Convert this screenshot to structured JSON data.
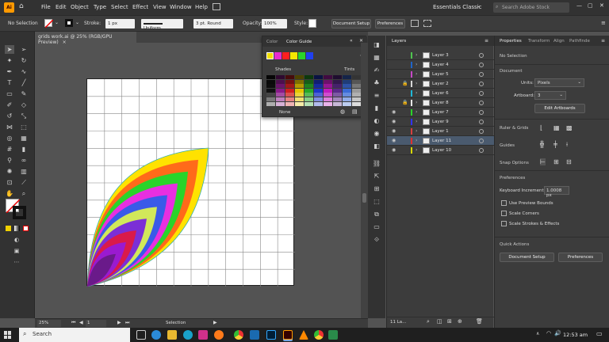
{
  "menubar": {
    "app_logo": "Ai",
    "items": [
      "File",
      "Edit",
      "Object",
      "Type",
      "Select",
      "Effect",
      "View",
      "Window",
      "Help"
    ],
    "workspace": "Essentials Classic",
    "search_placeholder": "Search Adobe Stock"
  },
  "control_bar": {
    "selection_label": "No Selection",
    "stroke_label": "Stroke:",
    "stroke_value": "1 px",
    "uniform": "Uniform",
    "brush": "3 pt. Round",
    "opacity_label": "Opacity:",
    "opacity_value": "100%",
    "style_label": "Style:",
    "document_setup": "Document Setup",
    "preferences": "Preferences"
  },
  "document": {
    "tab_title": "grids work.ai @ 25% (RGB/GPU Preview)",
    "close": "×"
  },
  "status_bar": {
    "zoom": "25%",
    "artboard_num": "1",
    "status": "Selection"
  },
  "color_guide": {
    "tab_color": "Color",
    "tab_guide": "Color Guide",
    "shades_label": "Shades",
    "tints_label": "Tints",
    "none_label": "None",
    "harmony": [
      "#f2e000",
      "#e62cd2",
      "#ff1f1f",
      "#f5e600",
      "#2ad42a",
      "#2040f0"
    ],
    "grid_columns": [
      "#111111",
      "#8a1a8a",
      "#d01f1f",
      "#e5c600",
      "#27a827",
      "#1c36c9",
      "#c01cc0",
      "#5a2a8a",
      "#3a6bd6",
      "#9a9a9a"
    ]
  },
  "layers_panel": {
    "title": "Layers",
    "layers": [
      {
        "name": "Layer 3",
        "visible": false,
        "locked": false,
        "color": "#4fc54f",
        "selected": false
      },
      {
        "name": "Layer 4",
        "visible": false,
        "locked": false,
        "color": "#1f64c8",
        "selected": false
      },
      {
        "name": "Layer 5",
        "visible": false,
        "locked": false,
        "color": "#c848c8",
        "selected": false
      },
      {
        "name": "Layer 2",
        "visible": false,
        "locked": true,
        "color": "#d8d8d8",
        "selected": false
      },
      {
        "name": "Layer 6",
        "visible": false,
        "locked": false,
        "color": "#1fb8d8",
        "selected": false
      },
      {
        "name": "Layer 8",
        "visible": false,
        "locked": true,
        "color": "#e8e8e8",
        "selected": false
      },
      {
        "name": "Layer 7",
        "visible": true,
        "locked": false,
        "color": "#2ad42a",
        "selected": false
      },
      {
        "name": "Layer 9",
        "visible": true,
        "locked": false,
        "color": "#3232ff",
        "selected": false
      },
      {
        "name": "Layer 1",
        "visible": true,
        "locked": false,
        "color": "#d84040",
        "selected": false
      },
      {
        "name": "Layer 11",
        "visible": true,
        "locked": false,
        "color": "#e03030",
        "selected": true
      },
      {
        "name": "Layer 10",
        "visible": true,
        "locked": false,
        "color": "#d8d800",
        "selected": false
      }
    ],
    "count": "11 La..."
  },
  "properties_panel": {
    "tabs": [
      "Properties",
      "Transform",
      "Align",
      "Pathfinde"
    ],
    "no_selection": "No Selection",
    "document_header": "Document",
    "units_label": "Units:",
    "units_value": "Pixels",
    "artboard_label": "Artboard:",
    "artboard_value": "3",
    "edit_artboards": "Edit Artboards",
    "ruler_grids": "Ruler & Grids",
    "guides": "Guides",
    "snap_options": "Snap Options",
    "preferences_header": "Preferences",
    "keyboard_increment_label": "Keyboard Increment:",
    "keyboard_increment_value": "1.0008 px",
    "use_preview_bounds": "Use Preview Bounds",
    "scale_corners": "Scale Corners",
    "scale_strokes": "Scale Strokes & Effects",
    "quick_actions": "Quick Actions",
    "document_setup_btn": "Document Setup",
    "preferences_btn": "Preferences"
  },
  "taskbar": {
    "search_placeholder": "Search",
    "time": "12:53 am"
  },
  "artwork_colors": {
    "arcs": [
      "#ffe200",
      "#ff6a1a",
      "#2ad42a",
      "#e82fe0",
      "#3a5ae8",
      "#d1e85a",
      "#7b2fd6",
      "#d91a4a",
      "#9a1ad0",
      "#6a1a8a"
    ],
    "outline": "#35b0b0"
  }
}
